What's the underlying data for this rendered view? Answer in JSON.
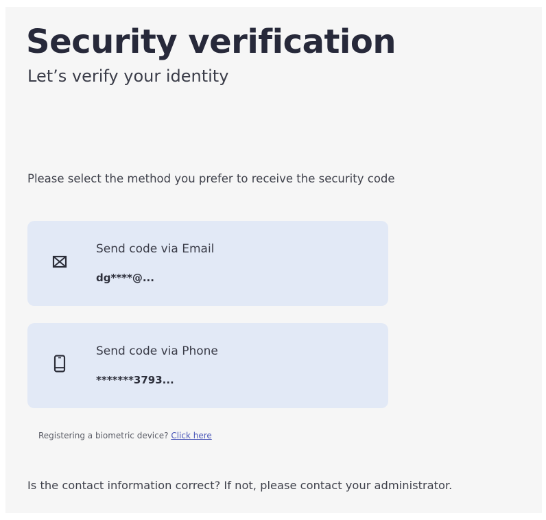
{
  "header": {
    "title": "Security verification",
    "subtitle": "Let’s verify your identity"
  },
  "instruction": "Please select the method you prefer to receive the security code",
  "methods": [
    {
      "label": "Send code via Email",
      "value": "dg****@...",
      "icon": "envelope-icon"
    },
    {
      "label": "Send code via Phone",
      "value": "*******3793...",
      "icon": "mobile-phone-icon"
    }
  ],
  "biometric": {
    "text": "Registering a biometric device?",
    "link": "Click here"
  },
  "contact_note": "Is the contact information correct? If not, please contact your administrator.",
  "colors": {
    "card_background": "#e2e9f6",
    "title_text": "#27293a",
    "link": "#4a56b8"
  }
}
